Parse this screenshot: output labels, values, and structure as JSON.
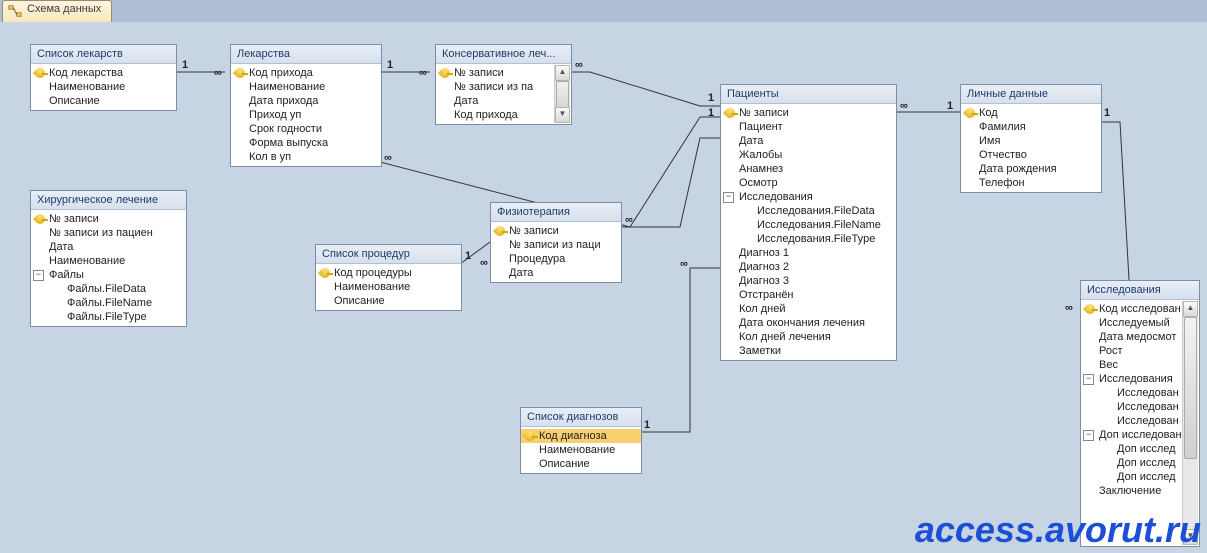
{
  "tab": {
    "title": "Схема данных"
  },
  "tables": {
    "drugs_list": {
      "title": "Список лекарств",
      "fields": [
        "Код лекарства",
        "Наименование",
        "Описание"
      ]
    },
    "drugs": {
      "title": "Лекарства",
      "fields": [
        "Код прихода",
        "Наименование",
        "Дата прихода",
        "Приход уп",
        "Срок годности",
        "Форма выпуска",
        "Кол в уп"
      ]
    },
    "cons_treat": {
      "title": "Консервативное леч...",
      "fields": [
        "№ записи",
        "№ записи из па",
        "Дата",
        "Код прихода"
      ]
    },
    "patients": {
      "title": "Пациенты",
      "fields": [
        "№ записи",
        "Пациент",
        "Дата",
        "Жалобы",
        "Анамнез",
        "Осмотр",
        "Исследования",
        "Исследования.FileData",
        "Исследования.FileName",
        "Исследования.FileType",
        "Диагноз 1",
        "Диагноз 2",
        "Диагноз 3",
        "Отстранён",
        "Кол дней",
        "Дата окончания лечения",
        "Кол дней лечения",
        "Заметки"
      ]
    },
    "personal": {
      "title": "Личные данные",
      "fields": [
        "Код",
        "Фамилия",
        "Имя",
        "Отчество",
        "Дата рождения",
        "Телефон"
      ]
    },
    "surgery": {
      "title": "Хирургическое лечение",
      "fields": [
        "№ записи",
        "№ записи из пациен",
        "Дата",
        "Наименование",
        "Файлы",
        "Файлы.FileData",
        "Файлы.FileName",
        "Файлы.FileType"
      ]
    },
    "physio": {
      "title": "Физиотерапия",
      "fields": [
        "№ записи",
        "№ записи из паци",
        "Процедура",
        "Дата"
      ]
    },
    "proc_list": {
      "title": "Список процедур",
      "fields": [
        "Код процедуры",
        "Наименование",
        "Описание"
      ]
    },
    "diag_list": {
      "title": "Список диагнозов",
      "fields": [
        "Код диагноза",
        "Наименование",
        "Описание"
      ]
    },
    "research": {
      "title": "Исследования",
      "fields": [
        "Код исследован",
        "Исследуемый",
        "Дата медосмот",
        "Рост",
        "Вес",
        "Исследования",
        "Исследован",
        "Исследован",
        "Исследован",
        "Доп исследован",
        "Доп исслед",
        "Доп исслед",
        "Доп исслед",
        "Заключение"
      ]
    }
  },
  "relationships": [
    {
      "from": "drugs_list",
      "to": "drugs",
      "fromCard": "1",
      "toCard": "∞"
    },
    {
      "from": "drugs",
      "to": "cons_treat",
      "fromCard": "1",
      "toCard": "∞"
    },
    {
      "from": "patients",
      "to": "cons_treat",
      "fromCard": "1",
      "toCard": "∞"
    },
    {
      "from": "personal",
      "to": "patients",
      "fromCard": "1",
      "toCard": "∞"
    },
    {
      "from": "patients",
      "to": "surgery",
      "fromCard": "1",
      "toCard": "∞"
    },
    {
      "from": "proc_list",
      "to": "physio",
      "fromCard": "1",
      "toCard": "∞"
    },
    {
      "from": "patients",
      "to": "physio",
      "fromCard": "1",
      "toCard": "∞"
    },
    {
      "from": "diag_list",
      "to": "patients",
      "fromCard": "1",
      "toCard": "∞"
    },
    {
      "from": "personal",
      "to": "research",
      "fromCard": "1",
      "toCard": "∞"
    }
  ],
  "watermark": "access.avorut.ru"
}
